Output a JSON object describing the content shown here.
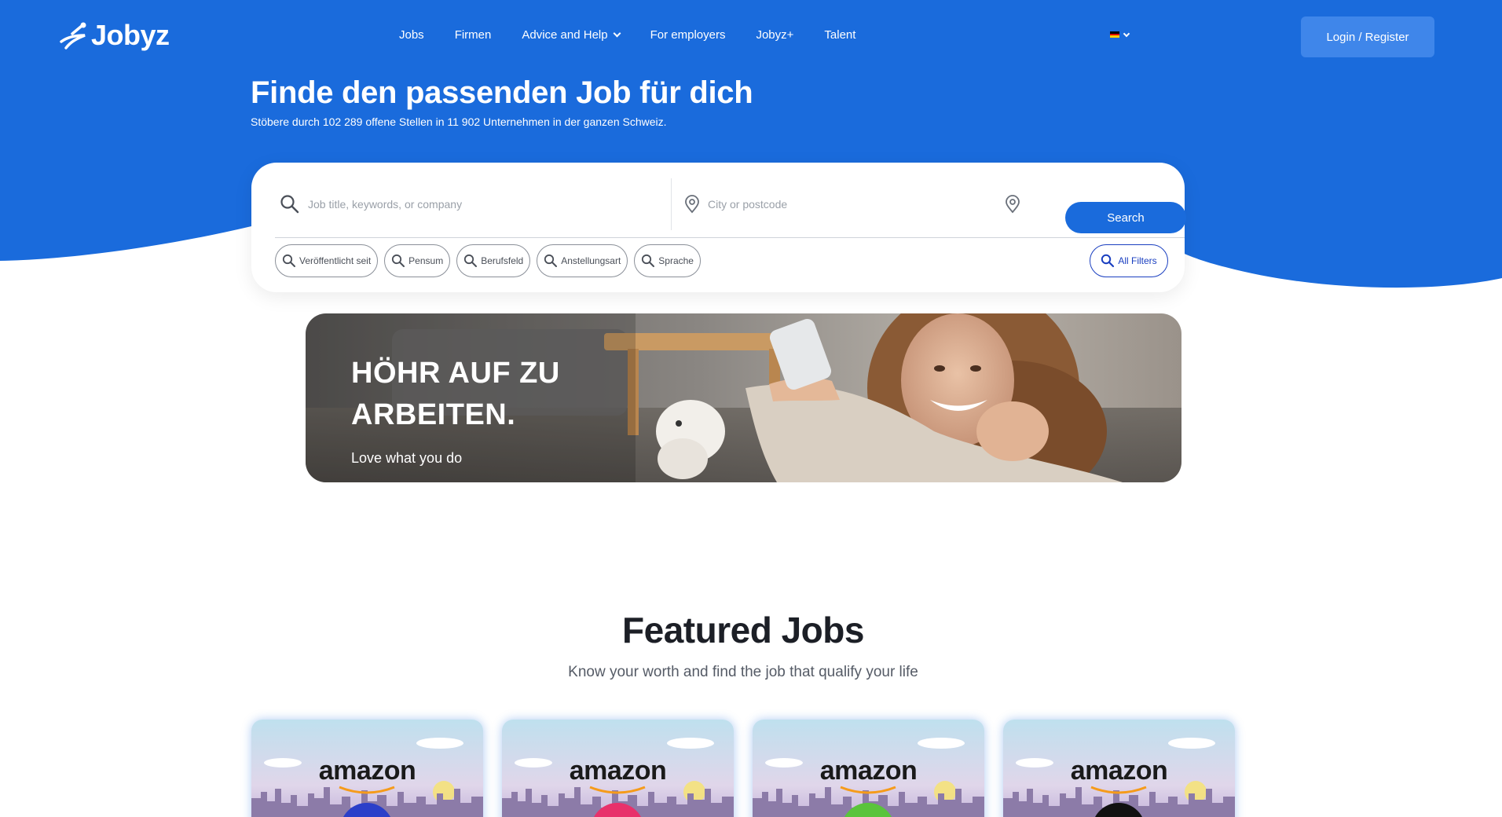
{
  "brand": {
    "name": "Jobyz",
    "primary_color": "#1a6bdc"
  },
  "nav": {
    "items": [
      {
        "label": "Jobs"
      },
      {
        "label": "Firmen"
      },
      {
        "label": "Advice and Help",
        "has_dropdown": true
      },
      {
        "label": "For employers"
      },
      {
        "label": "Jobyz+"
      },
      {
        "label": "Talent"
      }
    ]
  },
  "language": {
    "flag": "de-flag-icon"
  },
  "header": {
    "login_label": "Login / Register"
  },
  "hero": {
    "title": "Finde den passenden Job für dich",
    "subtitle": "Stöbere durch 102 289 offene Stellen in 11 902 Unternehmen in der ganzen Schweiz."
  },
  "search": {
    "job_placeholder": "Job title, keywords, or company",
    "location_placeholder": "City or postcode",
    "button_label": "Search",
    "filters": [
      {
        "label": "Veröffentlicht seit"
      },
      {
        "label": "Pensum"
      },
      {
        "label": "Berufsfeld"
      },
      {
        "label": "Anstellungsart"
      },
      {
        "label": "Sprache"
      }
    ],
    "all_filters_label": "All Filters"
  },
  "banner": {
    "title": "HÖHR AUF ZU ARBEITEN.",
    "subtitle": "Love what you do"
  },
  "featured": {
    "title": "Featured Jobs",
    "subtitle": "Know your worth and find the job that qualify your life",
    "cards": [
      {
        "company": "amazon",
        "badge_color": "#2b3fc9"
      },
      {
        "company": "amazon",
        "badge_color": "#e8316b"
      },
      {
        "company": "amazon",
        "badge_color": "#5ac43c"
      },
      {
        "company": "amazon",
        "badge_color": "#111111"
      }
    ]
  }
}
